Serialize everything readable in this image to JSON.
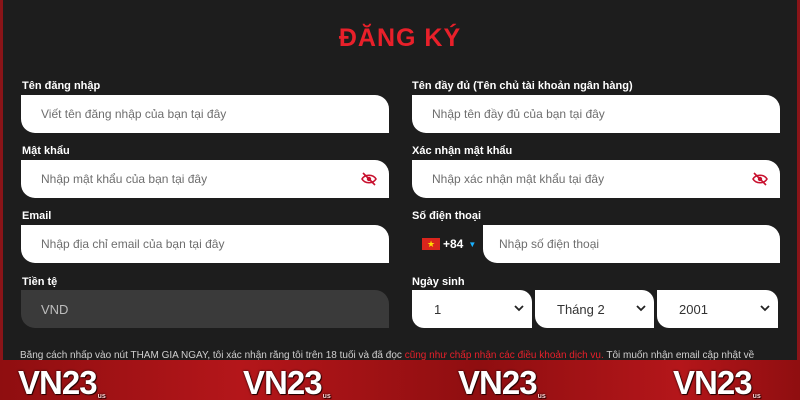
{
  "title": "ĐĂNG KÝ",
  "fields": {
    "username": {
      "label": "Tên đăng nhập",
      "placeholder": "Viết tên đăng nhập của bạn tại đây"
    },
    "fullname": {
      "label": "Tên đầy đủ (Tên chủ tài khoản ngân hàng)",
      "placeholder": "Nhập tên đầy đủ của bạn tại đây"
    },
    "password": {
      "label": "Mật khẩu",
      "placeholder": "Nhập mật khẩu của bạn tại đây"
    },
    "confirm_password": {
      "label": "Xác nhận mật khẩu",
      "placeholder": "Nhập xác nhận mật khẩu tại đây"
    },
    "email": {
      "label": "Email",
      "placeholder": "Nhập địa chỉ email của bạn tại đây"
    },
    "phone": {
      "label": "Số điện thoại",
      "country_code": "+84",
      "placeholder": "Nhập số điện thoại"
    },
    "currency": {
      "label": "Tiền tệ",
      "value": "VND"
    },
    "birthdate": {
      "label": "Ngày sinh",
      "day": "1",
      "month": "Tháng 2",
      "year": "2001"
    }
  },
  "terms": {
    "text_before": "Bằng cách nhấp vào nút THAM GIA NGAY, tôi xác nhận rằng tôi trên 18 tuổi và đã đọc",
    "link_text": "cũng như chấp nhận các điều khoản dịch vụ.",
    "text_after": "Tôi muốn nhận email cập nhật về"
  },
  "brand": {
    "logo_text": "VN23",
    "logo_suffix": "us"
  },
  "colors": {
    "accent": "#e8202a",
    "background": "#1d1d1d",
    "banner": "#a31216",
    "caret": "#19b1ff"
  },
  "icons": {
    "password_toggle": "eye-off-icon",
    "confirm_toggle": "eye-off-icon",
    "flag": "vietnam-flag-icon",
    "country_caret": "caret-down-icon",
    "select_chevron": "chevron-down-icon"
  }
}
